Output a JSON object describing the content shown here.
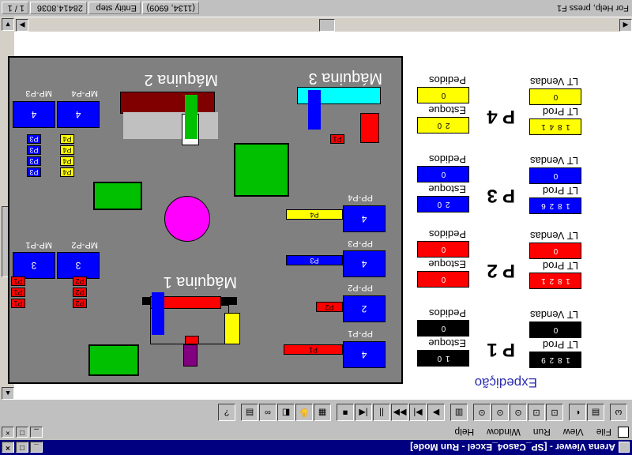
{
  "window": {
    "title": "Arena Viewer - [SP_Caso4_Excel - Run Mode]",
    "min": "_",
    "max": "□",
    "close": "×"
  },
  "menu": {
    "items": [
      "File",
      "View",
      "Run",
      "Window",
      "Help"
    ]
  },
  "toolbar": {
    "buttons": [
      "ω",
      "▤",
      "◐",
      "⊡",
      "⊡",
      "⊙",
      "⊙",
      "⊙",
      "▥",
      "▶",
      "▶|",
      "▶▶",
      "||",
      "|◀",
      "■",
      "▦",
      "✋",
      "◧",
      "∞",
      "▤",
      "?"
    ]
  },
  "status": {
    "help": "For Help, press F1",
    "mode": "Entity step",
    "coords": "(1134, 6909)",
    "time": "28414.8036",
    "page": "1 / 1"
  },
  "floor": {
    "machine1": "Máquina 1",
    "machine2": "Máquina 2",
    "machine3": "Máquina 3",
    "mp_p1": "MP-P1",
    "mp_p2": "MP-P2",
    "mp_p3": "MP-P3",
    "mp_p4": "MP-P4",
    "mp_p1_q": "3",
    "mp_p2_q": "3",
    "mp_p3_q": "4",
    "mp_p4_q": "4",
    "pp_p1": "PP-P1",
    "pp_p2": "PP-P2",
    "pp_p3": "PP-P3",
    "pp_p4": "PP-P4",
    "pp_p1_q": "4",
    "pp_p2_q": "2",
    "pp_p3_q": "4",
    "pp_p4_q": "4",
    "p1": "P1",
    "p2": "P2",
    "p3": "P3",
    "p4": "P4"
  },
  "panel": {
    "expedicao": "Expedição",
    "pedidos": "Pedidos",
    "estoque": "Estoque",
    "lt_vendas": "LT Vendas",
    "lt_prod": "LT Prod",
    "rows": [
      {
        "label": "P 1",
        "pedidos": "0",
        "estoque": "1 0",
        "lt_vendas": "0",
        "lt_prod": "1 8 2 9",
        "color": "#000000"
      },
      {
        "label": "P 2",
        "pedidos": "0",
        "estoque": "0",
        "lt_vendas": "0",
        "lt_prod": "1 8 2 1",
        "color": "#ff0000"
      },
      {
        "label": "P 3",
        "pedidos": "0",
        "estoque": "2 0",
        "lt_vendas": "0",
        "lt_prod": "1 8 2 6",
        "color": "#0000ff"
      },
      {
        "label": "P 4",
        "pedidos": "0",
        "estoque": "2 0",
        "lt_vendas": "0",
        "lt_prod": "1 8 4 1",
        "color": "#ffff00"
      }
    ]
  }
}
